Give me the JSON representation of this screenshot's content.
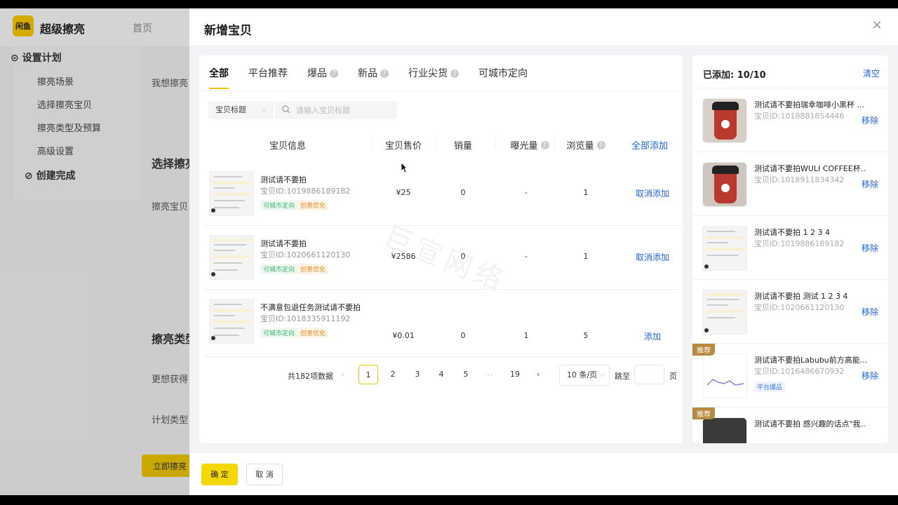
{
  "background": {
    "app_logo": "闲鱼",
    "app_name": "超级擦亮",
    "home": "首页",
    "sidebar": {
      "section1": "设置计划",
      "items": [
        "擦亮场景",
        "选择擦亮宝贝",
        "擦亮类型及预算",
        "高级设置"
      ],
      "section2": "创建完成"
    },
    "main_labels": [
      "我想擦亮",
      "选择擦亮",
      "擦亮宝贝",
      "擦亮类型",
      "更想获得",
      "计划类型"
    ],
    "submit_button": "立即擦亮"
  },
  "drawer": {
    "title": "新增宝贝",
    "close_icon": "close-icon"
  },
  "tabs": [
    {
      "label": "全部",
      "active": true,
      "help": false
    },
    {
      "label": "平台推荐",
      "active": false,
      "help": false
    },
    {
      "label": "爆品",
      "active": false,
      "help": true
    },
    {
      "label": "新品",
      "active": false,
      "help": true
    },
    {
      "label": "行业尖货",
      "active": false,
      "help": true
    },
    {
      "label": "可城市定向",
      "active": false,
      "help": false
    }
  ],
  "filter": {
    "select_value": "宝贝标题",
    "search_placeholder": "请输入宝贝标题"
  },
  "table": {
    "headers": {
      "info": "宝贝信息",
      "price": "宝贝售价",
      "sales": "销量",
      "exposure": "曝光量",
      "views": "浏览量",
      "add_all": "全部添加"
    },
    "rows": [
      {
        "title": "测试请不要拍",
        "id": "宝贝ID:1019886189182",
        "tag1": "可城市定向",
        "tag2": "创意优化",
        "price": "¥25",
        "sales": "0",
        "exposure": "-",
        "views": "1",
        "action": "取消添加"
      },
      {
        "title": "测试请不要拍",
        "id": "宝贝ID:1020661120130",
        "tag1": "可城市定向",
        "tag2": "创意优化",
        "price": "¥2586",
        "sales": "0",
        "exposure": "-",
        "views": "1",
        "action": "取消添加"
      },
      {
        "title": "不满意包退任务测试请不要拍",
        "id": "宝贝ID:1018335911192",
        "tag1": "可城市定向",
        "tag2": "创意优化",
        "price": "¥0.01",
        "sales": "0",
        "exposure": "1",
        "views": "5",
        "action": "添加"
      }
    ]
  },
  "pagination": {
    "total": "共182项数据",
    "pages": [
      "1",
      "2",
      "3",
      "4",
      "5"
    ],
    "ellipsis": "···",
    "last_page": "19",
    "current": "1",
    "page_size": "10 条/页",
    "jump_label": "跳至",
    "page_label": "页"
  },
  "watermark": "巨宣网络",
  "selected": {
    "title": "已添加: 10/10",
    "clear": "清空",
    "remove_label": "移除",
    "items": [
      {
        "name": "测试请不要拍瑞幸咖啡小黑杯 ...",
        "id": "宝贝ID:1018881854446",
        "badge": "",
        "tag": "",
        "thumb": "cup"
      },
      {
        "name": "测试请不要拍WULI COFFEE杯...",
        "id": "宝贝ID:1018911834342",
        "badge": "",
        "tag": "",
        "thumb": "cup"
      },
      {
        "name": "测试请不要拍 1 2 3 4",
        "id": "宝贝ID:1019886189182",
        "badge": "",
        "tag": "",
        "thumb": "doc"
      },
      {
        "name": "测试请不要拍 测试 1 2 3 4",
        "id": "宝贝ID:1020661120130",
        "badge": "",
        "tag": "",
        "thumb": "doc"
      },
      {
        "name": "测试请不要拍Labubu前方高能...",
        "id": "宝贝ID:1016486670932",
        "badge": "推荐",
        "tag": "平台爆品",
        "thumb": "chart"
      },
      {
        "name": "测试请不要拍 感兴趣的话点\"我...",
        "id": "",
        "badge": "推荐",
        "tag": "",
        "thumb": "dark"
      }
    ]
  },
  "footer": {
    "ok": "确 定",
    "cancel": "取 消"
  },
  "colors": {
    "accent": "#f5c400",
    "link": "#1e63d9"
  }
}
